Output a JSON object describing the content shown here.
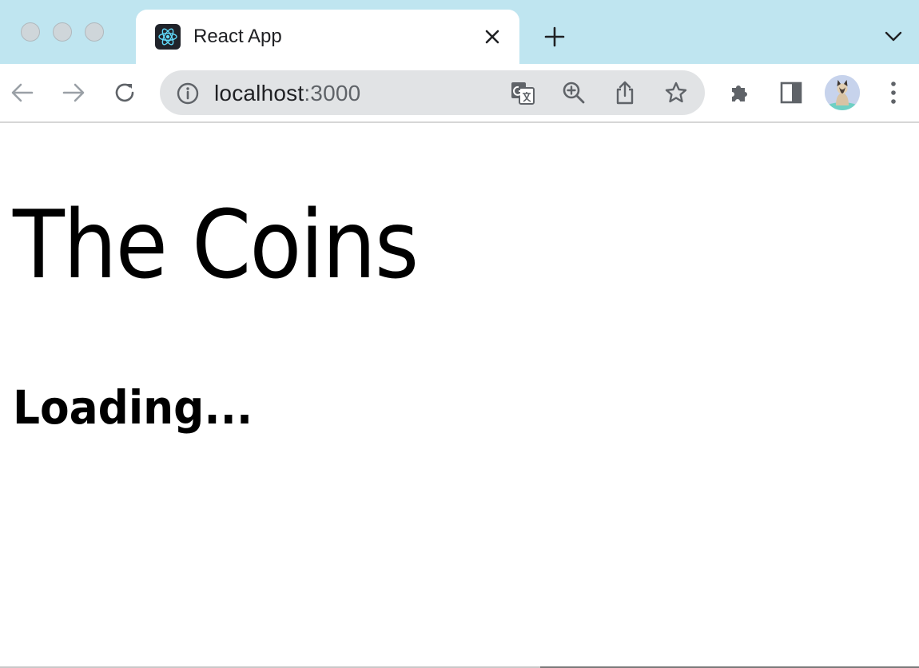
{
  "browser": {
    "tab": {
      "title": "React App",
      "favicon": "react-logo-icon",
      "close_icon": "close-icon"
    },
    "new_tab_icon": "plus-icon",
    "tab_search_icon": "chevron-down-icon",
    "toolbar": {
      "back_icon": "arrow-left-icon",
      "forward_icon": "arrow-right-icon",
      "reload_icon": "reload-icon",
      "extensions_icon": "puzzle-icon",
      "side_panel_icon": "side-panel-icon",
      "profile_icon": "avatar",
      "menu_icon": "kebab-menu-icon"
    },
    "omnibox": {
      "host": "localhost",
      "port": ":3000",
      "icons": [
        "info-icon",
        "translate-icon",
        "zoom-icon",
        "share-icon",
        "star-icon"
      ]
    },
    "colors": {
      "tabstrip": "#bfe5f0",
      "omnibox": "#e1e3e5",
      "icon": "#5f6368",
      "react": "#61dafb"
    }
  },
  "page": {
    "heading": "The Coins",
    "status": "Loading..."
  }
}
